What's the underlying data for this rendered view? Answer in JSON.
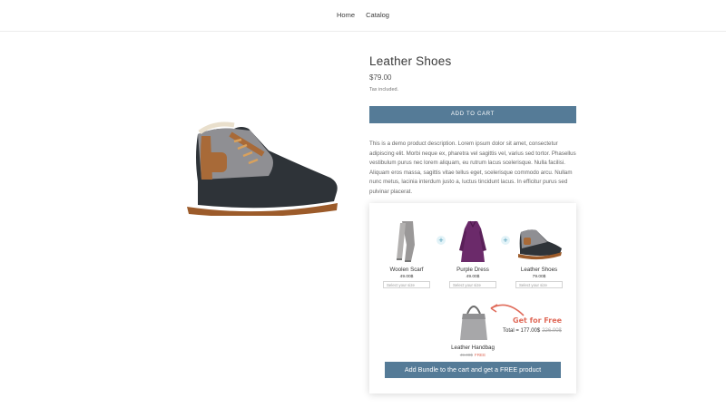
{
  "nav": {
    "items": [
      {
        "label": "Home"
      },
      {
        "label": "Catalog"
      }
    ]
  },
  "product": {
    "title": "Leather Shoes",
    "price": "$79.00",
    "tax_note": "Tax included.",
    "add_to_cart": "ADD TO CART",
    "description": "This is a demo product description. Lorem ipsum dolor sit amet, consectetur adipiscing elit. Morbi neque ex, pharetra vel sagittis vel, varius sed tortor. Phasellus vestibulum purus nec lorem aliquam, eu rutrum lacus scelerisque. Nulla facilisi. Aliquam eros massa, sagittis vitae tellus eget, scelerisque commodo arcu. Nullam nunc metus, lacinia interdum justo a, luctus tincidunt lacus. In efficitur purus sed pulvinar placerat."
  },
  "bundle": {
    "items": [
      {
        "name": "Woolen Scarf",
        "price": "49.00$",
        "select_placeholder": "Select your size"
      },
      {
        "name": "Purple Dress",
        "price": "49.00$",
        "select_placeholder": "Select your size"
      },
      {
        "name": "Leather Shoes",
        "price": "79.00$",
        "select_placeholder": "Select your size"
      }
    ],
    "plus_symbol": "+",
    "free_item": {
      "name": "Leather Handbag",
      "old_price": "49.00$",
      "free_label": "FREE"
    },
    "get_free_label": "Get for Free",
    "total_label": "Total = 177.00$",
    "total_old": "226.00$",
    "button_label": "Add Bundle to the cart and get a FREE product"
  },
  "colors": {
    "accent": "#557b97",
    "free": "#e06b5a",
    "plus_bg": "#e3f3f8"
  }
}
